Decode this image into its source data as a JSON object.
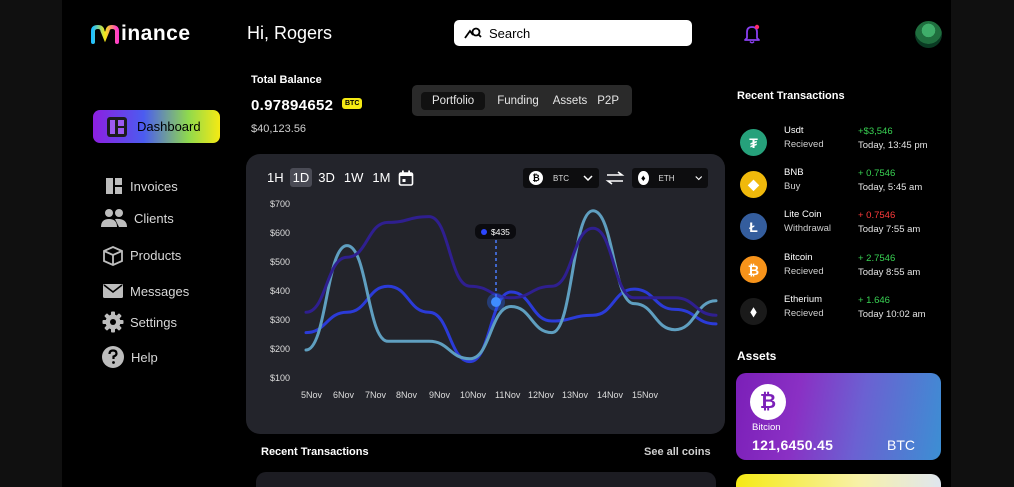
{
  "app": {
    "logo_text": "inance",
    "greeting": "Hi, Rogers"
  },
  "search": {
    "label": "Search"
  },
  "sidebar": {
    "dashboard": "Dashboard",
    "items": [
      {
        "label": "Invoices",
        "icon": "invoices-icon"
      },
      {
        "label": "Clients",
        "icon": "clients-icon"
      },
      {
        "label": "Products",
        "icon": "products-icon"
      },
      {
        "label": "Messages",
        "icon": "messages-icon"
      },
      {
        "label": "Settings",
        "icon": "gear-icon"
      },
      {
        "label": "Help",
        "icon": "help-icon"
      }
    ]
  },
  "balance": {
    "label": "Total Balance",
    "value": "0.97894652",
    "unit": "BTC",
    "usd": "$40,123.56"
  },
  "tabs": [
    "Portfolio",
    "Funding",
    "Assets",
    "P2P"
  ],
  "chart_controls": {
    "timeframes": [
      "1H",
      "1D",
      "3D",
      "1W",
      "1M"
    ],
    "active_timeframe": "1D",
    "from_coin": "BTC",
    "to_coin": "ETH",
    "tooltip": "$435"
  },
  "chart_data": {
    "type": "line",
    "y_ticks": [
      "$700",
      "$600",
      "$500",
      "$400",
      "$300",
      "$200",
      "$100"
    ],
    "x": [
      "5Nov",
      "6Nov",
      "7Nov",
      "8Nov",
      "9Nov",
      "10Nov",
      "11Nov",
      "12Nov",
      "13Nov",
      "14Nov",
      "15Nov"
    ],
    "ylim": [
      100,
      700
    ],
    "series": [
      {
        "color": "#2b3bd8",
        "values": [
          260,
          330,
          420,
          330,
          160,
          400,
          300,
          320,
          410,
          340,
          290
        ]
      },
      {
        "color": "#5f9fc0",
        "values": [
          200,
          560,
          230,
          230,
          170,
          350,
          260,
          680,
          360,
          270,
          370
        ]
      },
      {
        "color": "#2f1f90",
        "values": [
          330,
          520,
          640,
          660,
          420,
          380,
          420,
          620,
          380,
          380,
          320
        ]
      }
    ]
  },
  "recent_transactions_title": "Recent Transactions",
  "transactions": [
    {
      "name": "Usdt",
      "status": "Recieved",
      "amount": "+$3,546",
      "time": "Today, 13:45 pm",
      "icon": "tether-icon",
      "color": "#26a17b",
      "glyph": "₮",
      "sign": "pos"
    },
    {
      "name": "BNB",
      "status": "Buy",
      "amount": "+ 0.7546",
      "time": "Today, 5:45 am",
      "icon": "bnb-icon",
      "color": "#f0b90b",
      "glyph": "◆",
      "sign": "pos"
    },
    {
      "name": "Lite Coin",
      "status": "Withdrawal",
      "amount": "+ 0.7546",
      "time": "Today 7:55 am",
      "icon": "litecoin-icon",
      "color": "#345d9d",
      "glyph": "Ł",
      "sign": "neg"
    },
    {
      "name": "Bitcoin",
      "status": "Recieved",
      "amount": "+ 2.7546",
      "time": "Today 8:55 am",
      "icon": "bitcoin-icon",
      "color": "#f7931a",
      "glyph": "₿",
      "sign": "pos"
    },
    {
      "name": "Etherium",
      "status": "Recieved",
      "amount": "+ 1.646",
      "time": "Today 10:02 am",
      "icon": "ethereum-icon",
      "color": "#1a1a1a",
      "glyph": "⬧",
      "sign": "pos"
    }
  ],
  "bottom": {
    "title": "Recent Transactions",
    "see_all": "See all coins"
  },
  "assets": {
    "title": "Assets",
    "card": {
      "name": "Bitcion",
      "value": "121,6450.45",
      "symbol": "BTC",
      "glyph": "₿"
    }
  }
}
